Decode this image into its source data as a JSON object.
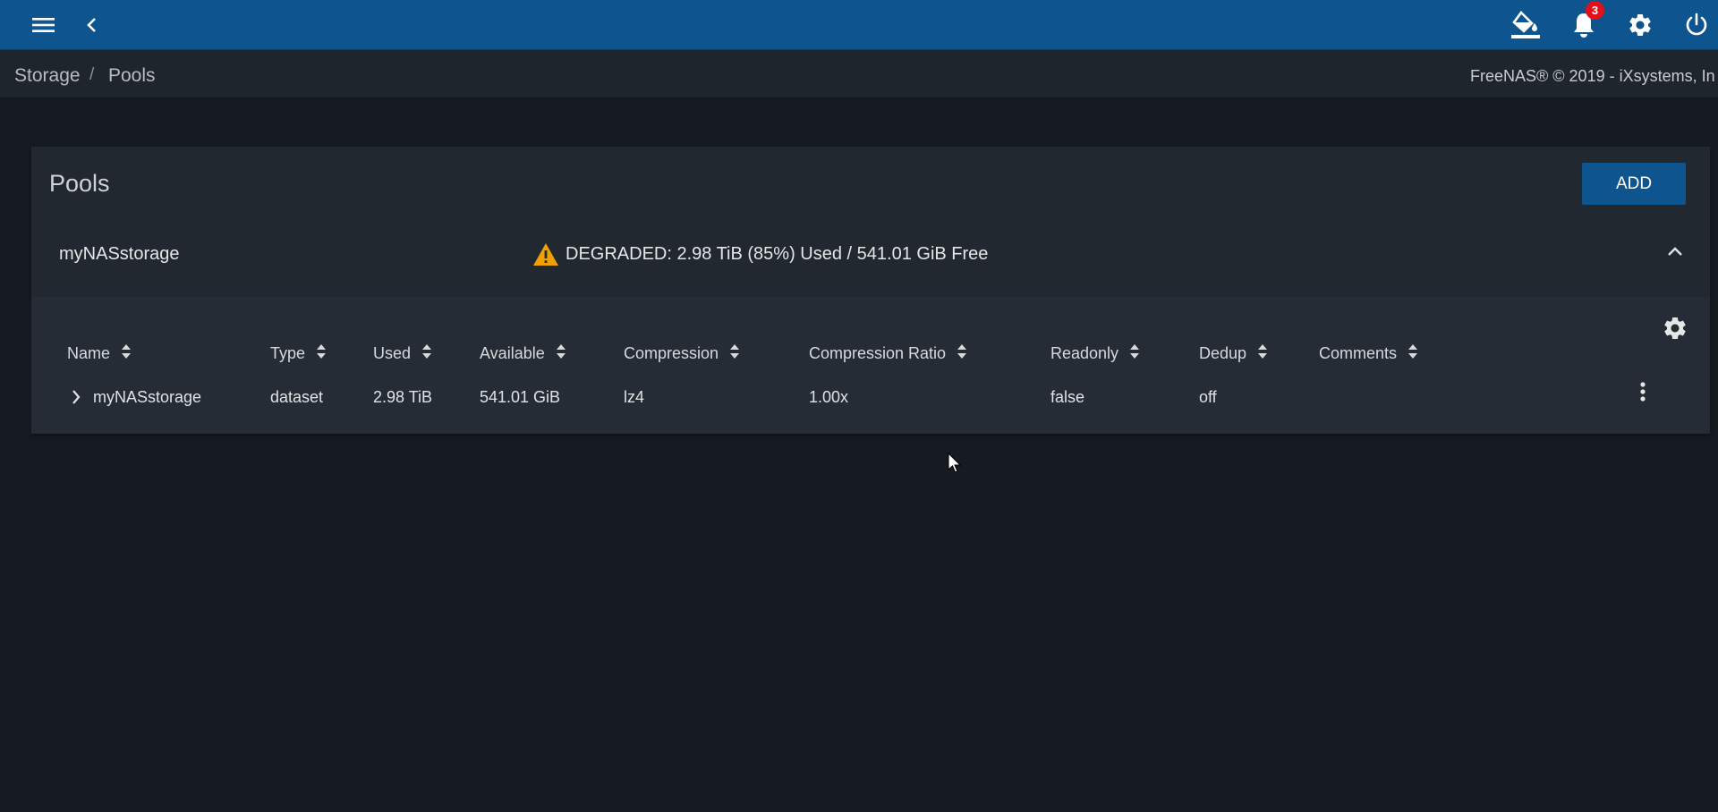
{
  "topbar": {
    "menu_icon": "menu-icon",
    "back_icon": "chevron-left-icon",
    "theme_icon": "paint-bucket-icon",
    "notifications_icon": "bell-icon",
    "notification_count": "3",
    "settings_icon": "gear-icon",
    "power_icon": "power-icon",
    "color": "#0e5590"
  },
  "breadcrumb": {
    "items": [
      "Storage",
      "Pools"
    ],
    "separator": "/"
  },
  "copyright": "FreeNAS® © 2019 - iXsystems, In",
  "card": {
    "title": "Pools",
    "add_label": "ADD"
  },
  "pool": {
    "name": "myNASstorage",
    "status": "DEGRADED: 2.98 TiB (85%) Used / 541.01 GiB Free",
    "status_icon": "warning-icon",
    "status_color": "#f0a000"
  },
  "table": {
    "columns": [
      "Name",
      "Type",
      "Used",
      "Available",
      "Compression",
      "Compression Ratio",
      "Readonly",
      "Dedup",
      "Comments"
    ],
    "rows": [
      {
        "name": "myNASstorage",
        "type": "dataset",
        "used": "2.98 TiB",
        "available": "541.01 GiB",
        "compression": "lz4",
        "compression_ratio": "1.00x",
        "readonly": "false",
        "dedup": "off",
        "comments": ""
      }
    ]
  }
}
